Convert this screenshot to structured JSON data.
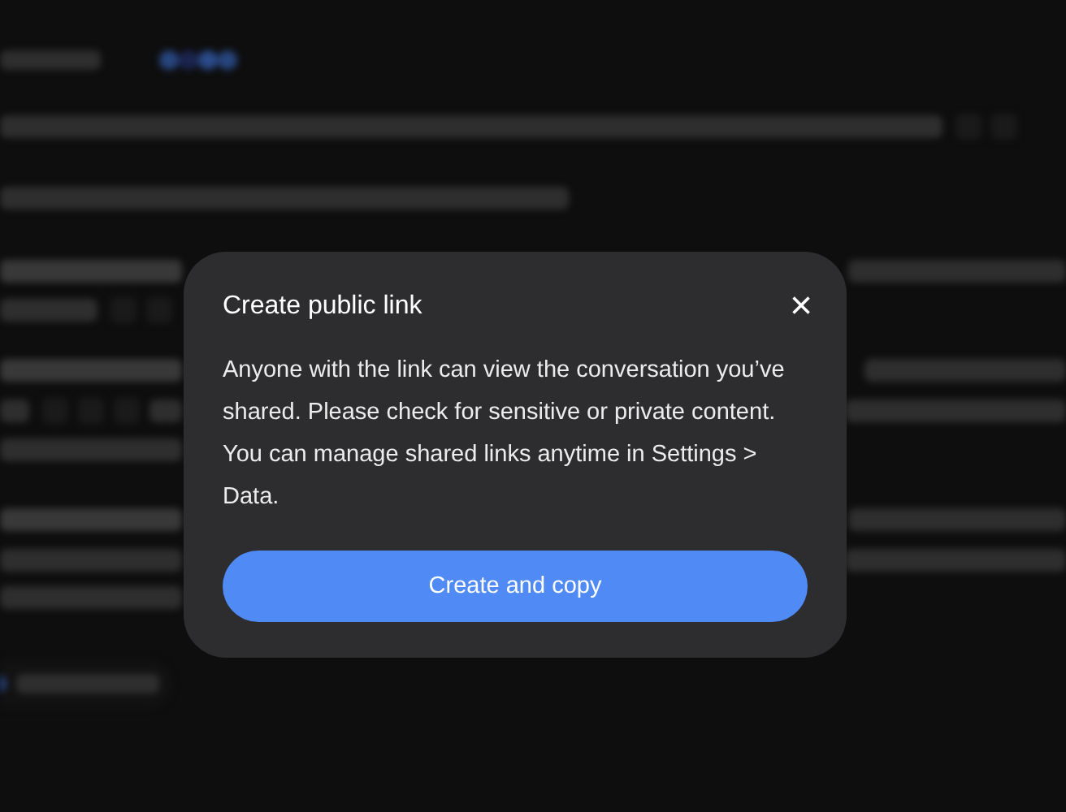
{
  "dialog": {
    "title": "Create public link",
    "close": "×",
    "message": "Anyone with the link can view the conversation you’ve shared. Please check for sensitive or private content. You can manage shared links anytime in Settings > Data.",
    "button": "Create and copy"
  }
}
